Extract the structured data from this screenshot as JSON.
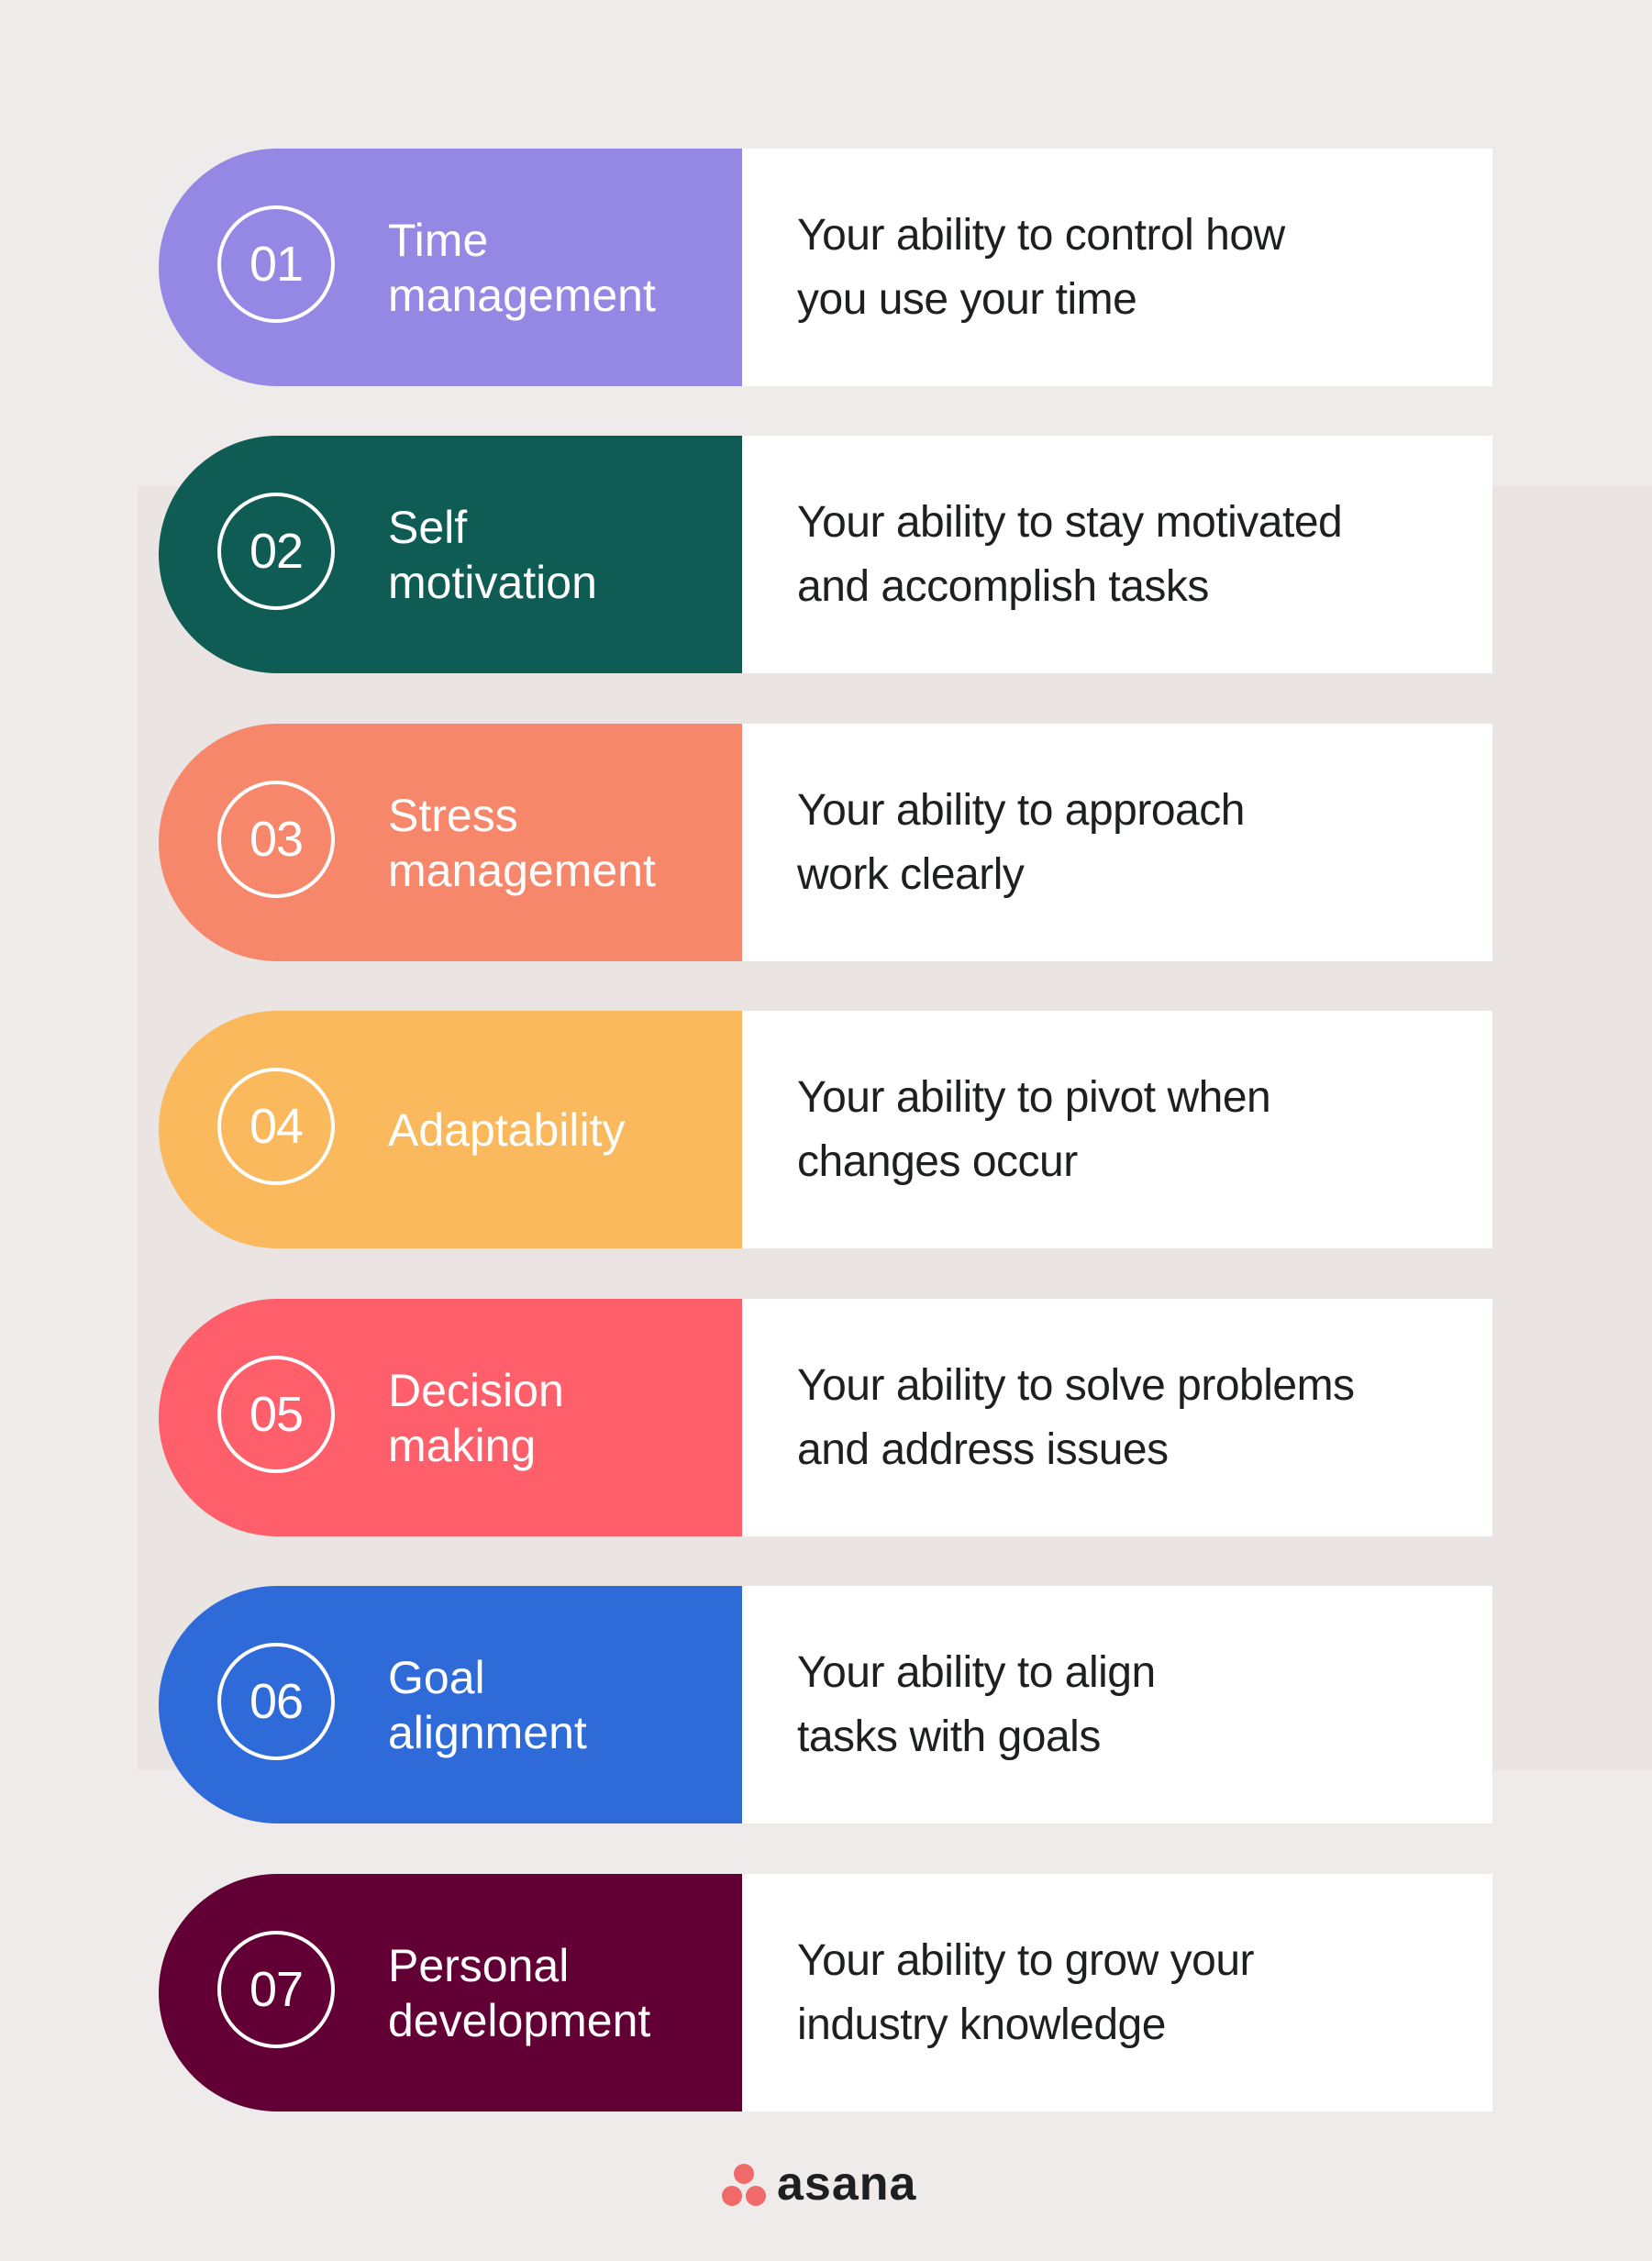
{
  "items": [
    {
      "number": "01",
      "label": "Time\nmanagement",
      "description": "Your ability to control how\nyou use your time",
      "color": "#9488e4"
    },
    {
      "number": "02",
      "label": "Self\nmotivation",
      "description": "Your ability to stay motivated\nand accomplish tasks",
      "color": "#0f5c54"
    },
    {
      "number": "03",
      "label": "Stress\nmanagement",
      "description": "Your ability to approach\nwork clearly",
      "color": "#f7876a"
    },
    {
      "number": "04",
      "label": "Adaptability",
      "description": "Your ability to pivot when\nchanges occur",
      "color": "#f9b95c"
    },
    {
      "number": "05",
      "label": "Decision\nmaking",
      "description": "Your ability to solve problems\nand address issues",
      "color": "#fe5f6a"
    },
    {
      "number": "06",
      "label": "Goal\nalignment",
      "description": "Your ability to align\ntasks with goals",
      "color": "#2f6bd8"
    },
    {
      "number": "07",
      "label": "Personal\ndevelopment",
      "description": "Your ability to grow your\nindustry knowledge",
      "color": "#620036"
    }
  ],
  "logo": {
    "text": "asana",
    "icon": "asana-dots-icon",
    "color": "#f06a6a"
  }
}
